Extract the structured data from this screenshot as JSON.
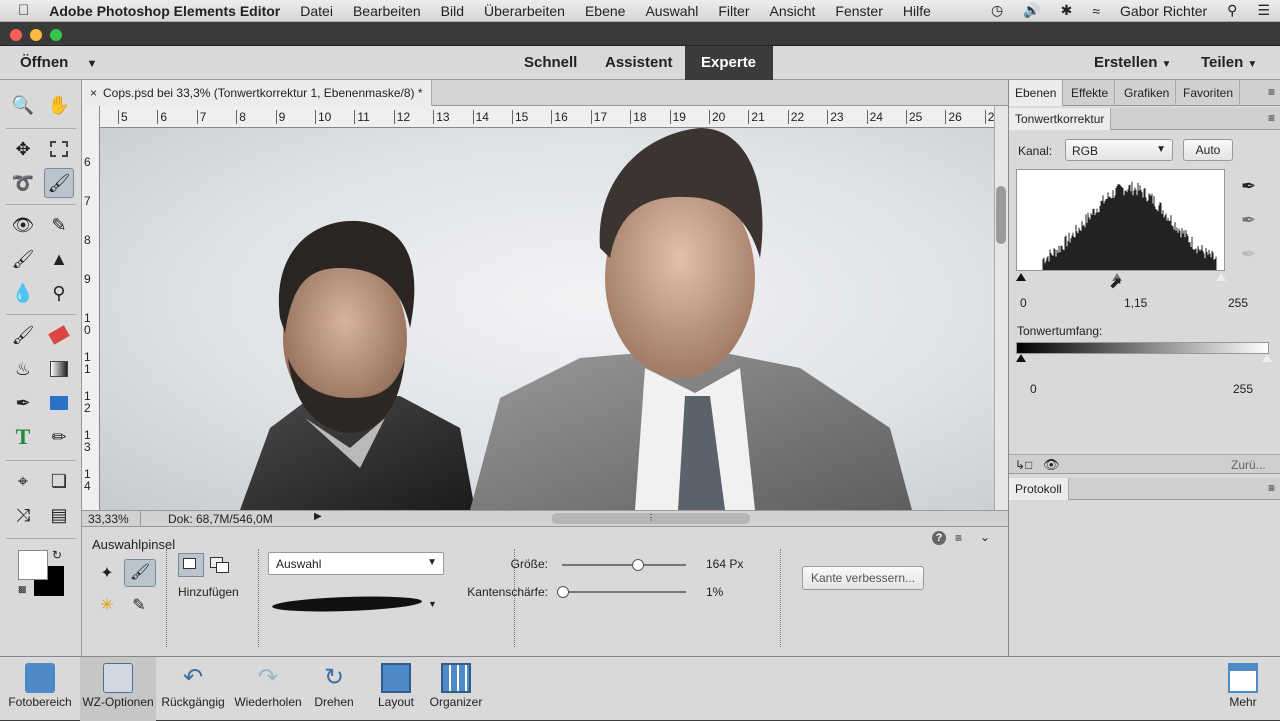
{
  "menubar": {
    "app": "Adobe Photoshop Elements Editor",
    "items": [
      "Datei",
      "Bearbeiten",
      "Bild",
      "Überarbeiten",
      "Ebene",
      "Auswahl",
      "Filter",
      "Ansicht",
      "Fenster",
      "Hilfe"
    ],
    "user": "Gabor Richter"
  },
  "modebar": {
    "open": "Öffnen",
    "modes": [
      "Schnell",
      "Assistent",
      "Experte"
    ],
    "active_mode": "Experte",
    "create": "Erstellen",
    "share": "Teilen"
  },
  "document": {
    "tab_title": "Cops.psd bei 33,3% (Tonwertkorrektur 1, Ebenenmaske/8) *",
    "ruler_h": [
      "5",
      "6",
      "7",
      "8",
      "9",
      "10",
      "11",
      "12",
      "13",
      "14",
      "15",
      "16",
      "17",
      "18",
      "19",
      "20",
      "21",
      "22",
      "23",
      "24",
      "25",
      "26",
      "2"
    ],
    "ruler_v": [
      "6",
      "7",
      "8",
      "9",
      "1 0",
      "1 1",
      "1 2",
      "1 3",
      "1 4"
    ],
    "zoom": "33,33%",
    "doc_size": "Dok: 68,7M/546,0M"
  },
  "options": {
    "tool_name": "Auswahlpinsel",
    "mode_label": "Hinzufügen",
    "mode_select": "Auswahl",
    "size_label": "Größe:",
    "size_value": "164 Px",
    "size_level": 0.61,
    "edge_label": "Kantenschärfe:",
    "edge_value": "1%",
    "edge_level": 0.01,
    "refine_button": "Kante verbessern..."
  },
  "panels": {
    "tabs": [
      "Ebenen",
      "Effekte",
      "Grafiken",
      "Favoriten"
    ],
    "active_tab": "Ebenen",
    "adjust_title": "Tonwertkorrektur",
    "channel_label": "Kanal:",
    "channel_value": "RGB",
    "auto_button": "Auto",
    "input_low": "0",
    "input_mid": "1,15",
    "input_high": "255",
    "output_label": "Tonwertumfang:",
    "output_low": "0",
    "output_high": "255",
    "reset_label": "Zurü...",
    "history_tab": "Protokoll"
  },
  "taskbar": {
    "items": [
      "Fotobereich",
      "WZ-Optionen",
      "Rückgängig",
      "Wiederholen",
      "Drehen",
      "Layout",
      "Organizer"
    ],
    "more": "Mehr"
  },
  "colors": {
    "accent": "#3b3b3b",
    "panel_bg": "#d9d9d9"
  }
}
